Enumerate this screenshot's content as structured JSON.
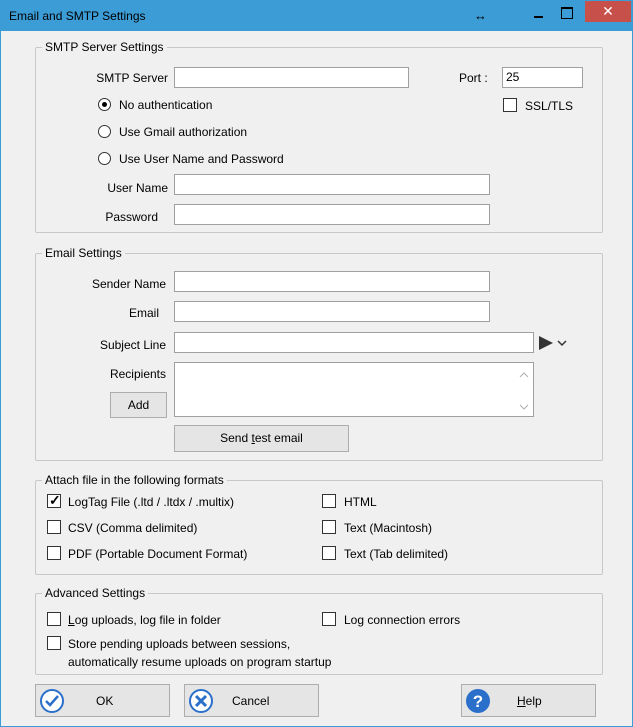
{
  "window": {
    "title": "Email and SMTP Settings",
    "controls": {
      "resize": "↔",
      "close": "✕"
    }
  },
  "smtp": {
    "legend": "SMTP Server Settings",
    "server_label": "SMTP Server",
    "server_value": "",
    "port_label": "Port :",
    "port_value": "25",
    "ssl_label": "SSL/TLS",
    "ssl_checked": false,
    "auth_options": [
      {
        "label": "No authentication",
        "selected": true
      },
      {
        "label": "Use Gmail authorization",
        "selected": false
      },
      {
        "label": "Use User Name and Password",
        "selected": false
      }
    ],
    "username_label": "User Name",
    "username_value": "",
    "password_label": "Password",
    "password_value": ""
  },
  "email": {
    "legend": "Email Settings",
    "sender_name_label": "Sender Name",
    "sender_name_value": "",
    "email_label": "Email",
    "email_value": "",
    "subject_label": "Subject Line",
    "subject_value": "",
    "recipients_label": "Recipients",
    "add_label": "Add",
    "send_test_prefix": "Send ",
    "send_test_underlined": "t",
    "send_test_suffix": "est email"
  },
  "attach": {
    "legend": "Attach file in the following formats",
    "formats": [
      {
        "label": "LogTag File (.ltd / .ltdx / .multix)",
        "checked": true
      },
      {
        "label": "HTML",
        "checked": false
      },
      {
        "label": "CSV (Comma delimited)",
        "checked": false
      },
      {
        "label": "Text (Macintosh)",
        "checked": false
      },
      {
        "label": "PDF (Portable Document Format)",
        "checked": false
      },
      {
        "label": "Text (Tab delimited)",
        "checked": false
      }
    ]
  },
  "advanced": {
    "legend": "Advanced Settings",
    "log_uploads_underlined": "L",
    "log_uploads_rest": "og uploads, log file in folder",
    "log_uploads_checked": false,
    "log_errors_label": "Log connection errors",
    "log_errors_checked": false,
    "store_pending_line1": "Store pending uploads between sessions,",
    "store_pending_line2": "automatically resume uploads on program startup",
    "store_pending_checked": false
  },
  "footer": {
    "ok_label": "OK",
    "cancel_label": "Cancel",
    "help_underlined": "H",
    "help_rest": "elp"
  },
  "colors": {
    "titlebar": "#3c9cd6",
    "close": "#c7504b",
    "icon_blue": "#2a6fc9"
  }
}
